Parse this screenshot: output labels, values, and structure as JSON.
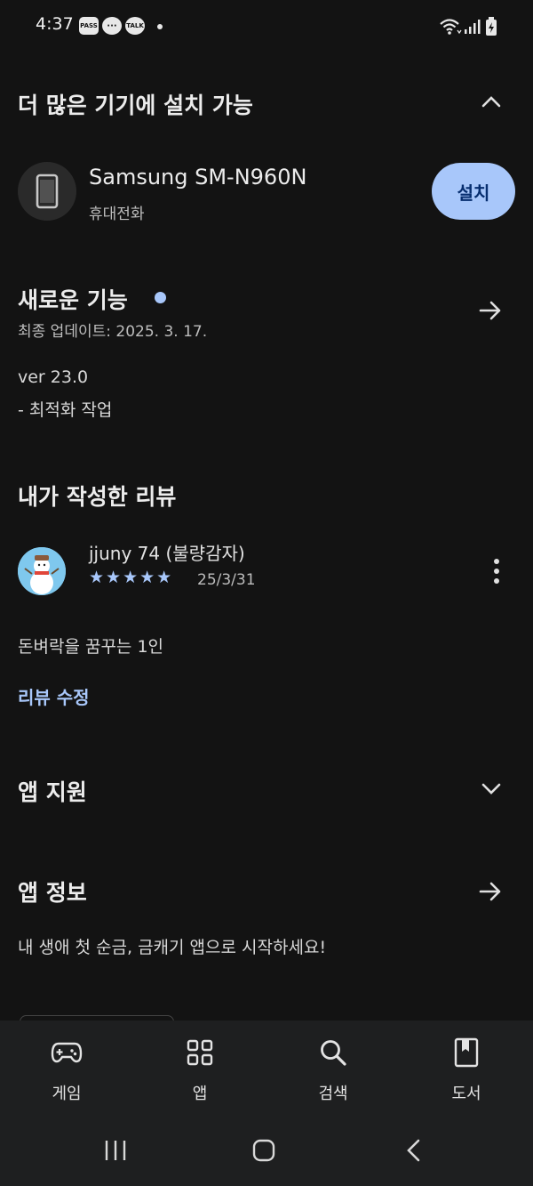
{
  "status_bar": {
    "time": "4:37",
    "notifications": [
      "PASS",
      "···",
      "TALK"
    ]
  },
  "more_devices": {
    "title": "더 많은 기기에 설치 가능",
    "device_name": "Samsung SM-N960N",
    "device_type": "휴대전화",
    "install_label": "설치"
  },
  "whats_new": {
    "title": "새로운 기능",
    "updated": "최종 업데이트: 2025. 3. 17.",
    "version": "ver 23.0",
    "notes": "- 최적화 작업"
  },
  "my_review": {
    "title": "내가 작성한 리뷰",
    "author": "jjuny 74 (불량감자)",
    "rating": 5,
    "stars": "★★★★★",
    "date": "25/3/31",
    "text": "돈벼락을 꿈꾸는 1인",
    "edit_label": "리뷰 수정"
  },
  "app_support": {
    "title": "앱 지원"
  },
  "app_info": {
    "title": "앱 정보",
    "description": "내 생애 첫 순금, 금캐기 앱으로 시작하세요!"
  },
  "bottom_nav": {
    "items": [
      {
        "label": "게임",
        "icon": "gamepad-icon"
      },
      {
        "label": "앱",
        "icon": "apps-grid-icon"
      },
      {
        "label": "검색",
        "icon": "search-icon"
      },
      {
        "label": "도서",
        "icon": "book-icon"
      }
    ]
  },
  "colors": {
    "background": "#131313",
    "accent": "#a8c7fa",
    "nav_background": "#1e1f20"
  }
}
